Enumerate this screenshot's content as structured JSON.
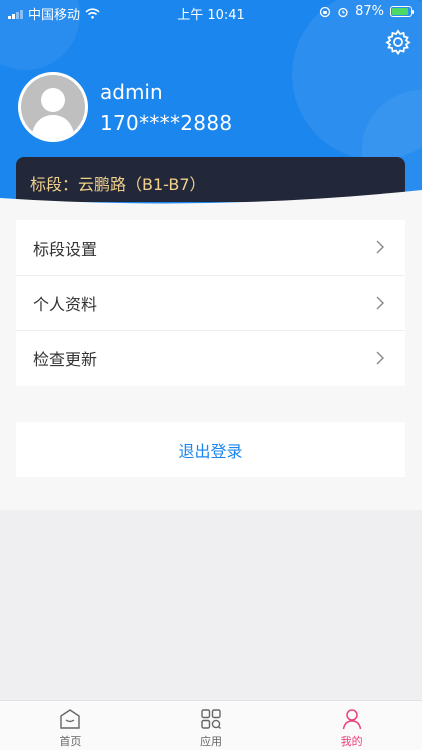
{
  "status_bar": {
    "carrier": "中国移动",
    "time": "上午 10:41",
    "battery": "87%",
    "battery_level": 0.87
  },
  "profile": {
    "username": "admin",
    "phone": "170****2888",
    "section_label": "标段：云鹏路（B1-B7）"
  },
  "menu": {
    "items": [
      {
        "label": "标段设置"
      },
      {
        "label": "个人资料"
      },
      {
        "label": "检查更新"
      }
    ],
    "logout_label": "退出登录"
  },
  "tabbar": {
    "tabs": [
      {
        "label": "首页",
        "icon": "home-icon"
      },
      {
        "label": "应用",
        "icon": "apps-icon"
      },
      {
        "label": "我的",
        "icon": "person-icon"
      }
    ],
    "active_index": 2
  },
  "colors": {
    "header_blue": "#1b86ee",
    "section_text": "#f0d08a",
    "active_tab": "#ec407a"
  }
}
